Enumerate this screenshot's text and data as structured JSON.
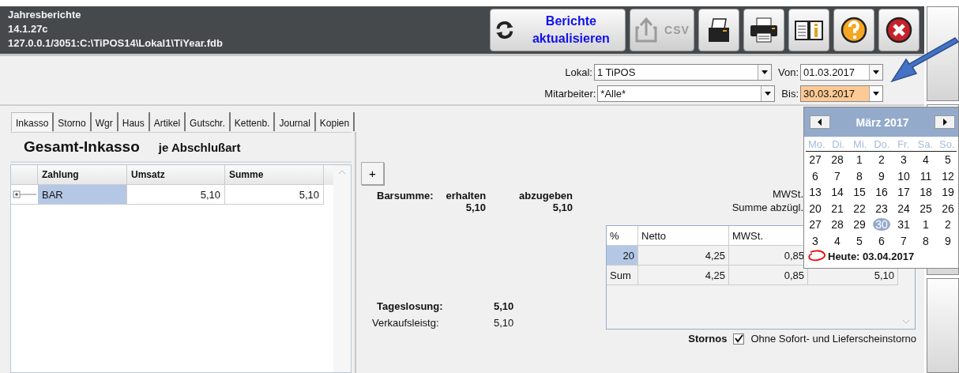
{
  "header": {
    "title": "Jahresberichte",
    "version": "14.1.27c",
    "database": "127.0.0.1/3051:C:\\TiPOS14\\Lokal1\\TiYear.fdb"
  },
  "toolbar": [
    {
      "kind": "refresh",
      "label": "Berichte aktualisieren"
    },
    {
      "kind": "export",
      "label": "CSV",
      "disabled": true
    },
    {
      "kind": "receipt-print"
    },
    {
      "kind": "a4-print"
    },
    {
      "kind": "manual"
    },
    {
      "kind": "help"
    },
    {
      "kind": "close"
    }
  ],
  "filters": {
    "lokal": {
      "label": "Lokal:",
      "value": "1 TiPOS"
    },
    "mitarbeiter": {
      "label": "Mitarbeiter:",
      "value": "*Alle*"
    },
    "von": {
      "label": "Von:",
      "value": "01.03.2017",
      "highlighted": false
    },
    "bis": {
      "label": "Bis:",
      "value": "30.03.2017",
      "highlighted": true
    }
  },
  "tabs": [
    {
      "label": "Inkasso",
      "selected": true
    },
    {
      "label": "Storno",
      "selected": false
    },
    {
      "label": "Wgr",
      "selected": false
    },
    {
      "label": "Haus",
      "selected": false
    },
    {
      "label": "Artikel",
      "selected": false
    },
    {
      "label": "Gutschr.",
      "selected": false
    },
    {
      "label": "Kettenb.",
      "selected": false
    },
    {
      "label": "Journal",
      "selected": false
    },
    {
      "label": "Kopien",
      "selected": false
    }
  ],
  "inkasso": {
    "title": "Gesamt-Inkasso",
    "subtitle": "je Abschlußart",
    "columns": [
      "Zahlung",
      "Umsatz",
      "Summe"
    ],
    "rows": [
      {
        "cells": [
          "BAR",
          "5,10",
          "5,10"
        ],
        "selected": true
      }
    ]
  },
  "summary": {
    "plus": "+",
    "barsumme": "Barsumme:",
    "erhalten": {
      "label": "erhalten",
      "value": "5,10"
    },
    "abzugeben": {
      "label": "abzugeben",
      "value": "5,10"
    },
    "tageslosung": {
      "label": "Tageslosung:",
      "value": "5,10"
    },
    "verkaufsleistung": {
      "label": "Verkaufsleistg:",
      "value": "5,10"
    }
  },
  "vat": {
    "mwst_label": "MWSt.",
    "net_label": "Summe abzügl.",
    "columns": [
      "%",
      "Netto",
      "MWSt."
    ],
    "rows": [
      {
        "cells": [
          "20",
          "4,25",
          "0,85"
        ],
        "selected": true
      },
      {
        "cells": [
          "Sum",
          "4,25",
          "0,85",
          "5,10"
        ],
        "selected": false
      }
    ]
  },
  "stornos": {
    "label": "Stornos",
    "option": "Ohne Sofort- und Lieferscheinstorno",
    "checked": true
  },
  "calendar": {
    "month": "März 2017",
    "weekdays": [
      "Mo.",
      "Di.",
      "Mi.",
      "Do.",
      "Fr.",
      "Sa.",
      "So."
    ],
    "weeks": [
      [
        {
          "day": "27",
          "selected": false
        },
        {
          "day": "28",
          "selected": false
        },
        {
          "day": "1",
          "selected": false
        },
        {
          "day": "2",
          "selected": false
        },
        {
          "day": "3",
          "selected": false
        },
        {
          "day": "4",
          "selected": false
        },
        {
          "day": "5",
          "selected": false
        }
      ],
      [
        {
          "day": "6",
          "selected": false
        },
        {
          "day": "7",
          "selected": false
        },
        {
          "day": "8",
          "selected": false
        },
        {
          "day": "9",
          "selected": false
        },
        {
          "day": "10",
          "selected": false
        },
        {
          "day": "11",
          "selected": false
        },
        {
          "day": "12",
          "selected": false
        }
      ],
      [
        {
          "day": "13",
          "selected": false
        },
        {
          "day": "14",
          "selected": false
        },
        {
          "day": "15",
          "selected": false
        },
        {
          "day": "16",
          "selected": false
        },
        {
          "day": "17",
          "selected": false
        },
        {
          "day": "18",
          "selected": false
        },
        {
          "day": "19",
          "selected": false
        }
      ],
      [
        {
          "day": "20",
          "selected": false
        },
        {
          "day": "21",
          "selected": false
        },
        {
          "day": "22",
          "selected": false
        },
        {
          "day": "23",
          "selected": false
        },
        {
          "day": "24",
          "selected": false
        },
        {
          "day": "25",
          "selected": false
        },
        {
          "day": "26",
          "selected": false
        }
      ],
      [
        {
          "day": "27",
          "selected": false
        },
        {
          "day": "28",
          "selected": false
        },
        {
          "day": "29",
          "selected": false
        },
        {
          "day": "30",
          "selected": true
        },
        {
          "day": "31",
          "selected": false
        },
        {
          "day": "1",
          "selected": false
        },
        {
          "day": "2",
          "selected": false
        }
      ],
      [
        {
          "day": "3",
          "selected": false
        },
        {
          "day": "4",
          "selected": false
        },
        {
          "day": "5",
          "selected": false
        },
        {
          "day": "6",
          "selected": false
        },
        {
          "day": "7",
          "selected": false
        },
        {
          "day": "8",
          "selected": false
        },
        {
          "day": "9",
          "selected": false
        }
      ]
    ],
    "today": "Heute: 03.04.2017"
  }
}
